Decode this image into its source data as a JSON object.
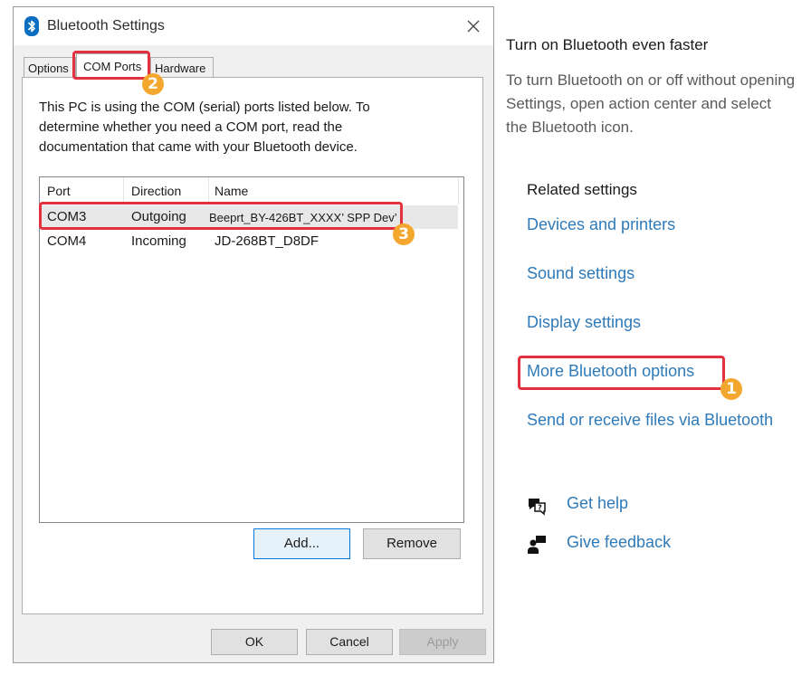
{
  "dialog": {
    "title": "Bluetooth Settings",
    "tabs": [
      {
        "label": "Options"
      },
      {
        "label": "COM Ports"
      },
      {
        "label": "Hardware"
      }
    ],
    "description": "This PC is using the COM (serial) ports listed below. To determine whether you need a COM port, read the documentation that came with your Bluetooth device.",
    "columns": [
      "Port",
      "Direction",
      "Name"
    ],
    "rows": [
      {
        "port": "COM3",
        "direction": "Outgoing",
        "name": "Beeprt_BY-426BT_XXXX’ SPP Dev’"
      },
      {
        "port": "COM4",
        "direction": "Incoming",
        "name": "JD-268BT_D8DF"
      }
    ],
    "add_label": "Add...",
    "remove_label": "Remove",
    "ok_label": "OK",
    "cancel_label": "Cancel",
    "apply_label": "Apply"
  },
  "annotations": {
    "badge1": "1",
    "badge2": "2",
    "badge3": "3",
    "color": "#e23240",
    "badge_color": "#f4a72e"
  },
  "right": {
    "title": "Turn on Bluetooth even faster",
    "description": "To turn Bluetooth on or off without opening Settings, open action center and select the Bluetooth icon.",
    "related_heading": "Related settings",
    "links": [
      {
        "label": "Devices and printers"
      },
      {
        "label": "Sound settings"
      },
      {
        "label": "Display settings"
      },
      {
        "label": "More Bluetooth options"
      },
      {
        "label": "Send or receive files via Bluetooth"
      }
    ],
    "get_help": "Get help",
    "give_feedback": "Give feedback",
    "link_color": "#2f7ab8"
  }
}
